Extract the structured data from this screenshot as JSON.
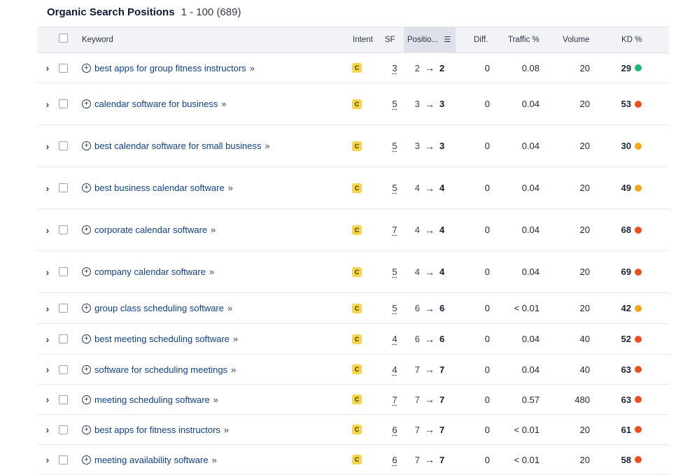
{
  "header": {
    "title": "Organic Search Positions",
    "range": "1 - 100 (689)"
  },
  "colors": {
    "green": "#22b776",
    "orange": "#f4a71b",
    "red": "#ef4d20",
    "intent": "#f7d54a"
  },
  "columns": {
    "keyword": "Keyword",
    "intent": "Intent",
    "sf": "SF",
    "position": "Positio...",
    "diff": "Diff.",
    "traffic": "Traffic %",
    "volume": "Volume",
    "kd": "KD %"
  },
  "rows": [
    {
      "keyword": "best apps for group fitness instructors",
      "intent": "C",
      "sf": "3",
      "from": "2",
      "to": "2",
      "diff": "0",
      "traffic": "0.08",
      "volume": "20",
      "kd": "29",
      "kd_color": "green"
    },
    {
      "keyword": "calendar software for business",
      "intent": "C",
      "sf": "5",
      "from": "3",
      "to": "3",
      "diff": "0",
      "traffic": "0.04",
      "volume": "20",
      "kd": "53",
      "kd_color": "red"
    },
    {
      "keyword": "best calendar software for small business",
      "intent": "C",
      "sf": "5",
      "from": "3",
      "to": "3",
      "diff": "0",
      "traffic": "0.04",
      "volume": "20",
      "kd": "30",
      "kd_color": "orange"
    },
    {
      "keyword": "best business calendar software",
      "intent": "C",
      "sf": "5",
      "from": "4",
      "to": "4",
      "diff": "0",
      "traffic": "0.04",
      "volume": "20",
      "kd": "49",
      "kd_color": "orange"
    },
    {
      "keyword": "corporate calendar software",
      "intent": "C",
      "sf": "7",
      "from": "4",
      "to": "4",
      "diff": "0",
      "traffic": "0.04",
      "volume": "20",
      "kd": "68",
      "kd_color": "red"
    },
    {
      "keyword": "company calendar software",
      "intent": "C",
      "sf": "5",
      "from": "4",
      "to": "4",
      "diff": "0",
      "traffic": "0.04",
      "volume": "20",
      "kd": "69",
      "kd_color": "red"
    },
    {
      "keyword": "group class scheduling software",
      "intent": "C",
      "sf": "5",
      "from": "6",
      "to": "6",
      "diff": "0",
      "traffic": "< 0.01",
      "volume": "20",
      "kd": "42",
      "kd_color": "orange"
    },
    {
      "keyword": "best meeting scheduling software",
      "intent": "C",
      "sf": "4",
      "from": "6",
      "to": "6",
      "diff": "0",
      "traffic": "0.04",
      "volume": "40",
      "kd": "52",
      "kd_color": "red"
    },
    {
      "keyword": "software for scheduling meetings",
      "intent": "C",
      "sf": "4",
      "from": "7",
      "to": "7",
      "diff": "0",
      "traffic": "0.04",
      "volume": "40",
      "kd": "63",
      "kd_color": "red"
    },
    {
      "keyword": "meeting scheduling software",
      "intent": "C",
      "sf": "7",
      "from": "7",
      "to": "7",
      "diff": "0",
      "traffic": "0.57",
      "volume": "480",
      "kd": "63",
      "kd_color": "red"
    },
    {
      "keyword": "best apps for fitness instructors",
      "intent": "C",
      "sf": "6",
      "from": "7",
      "to": "7",
      "diff": "0",
      "traffic": "< 0.01",
      "volume": "20",
      "kd": "61",
      "kd_color": "red"
    },
    {
      "keyword": "meeting availability software",
      "intent": "C",
      "sf": "6",
      "from": "7",
      "to": "7",
      "diff": "0",
      "traffic": "< 0.01",
      "volume": "20",
      "kd": "58",
      "kd_color": "red"
    }
  ]
}
